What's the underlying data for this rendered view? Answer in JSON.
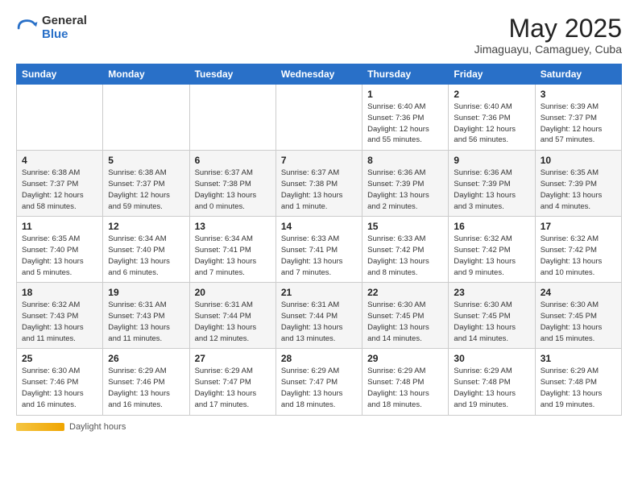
{
  "logo": {
    "general": "General",
    "blue": "Blue"
  },
  "title": "May 2025",
  "location": "Jimaguayu, Camaguey, Cuba",
  "days_of_week": [
    "Sunday",
    "Monday",
    "Tuesday",
    "Wednesday",
    "Thursday",
    "Friday",
    "Saturday"
  ],
  "footer": {
    "daylight_label": "Daylight hours"
  },
  "weeks": [
    [
      {
        "day": "",
        "info": ""
      },
      {
        "day": "",
        "info": ""
      },
      {
        "day": "",
        "info": ""
      },
      {
        "day": "",
        "info": ""
      },
      {
        "day": "1",
        "info": "Sunrise: 6:40 AM\nSunset: 7:36 PM\nDaylight: 12 hours\nand 55 minutes."
      },
      {
        "day": "2",
        "info": "Sunrise: 6:40 AM\nSunset: 7:36 PM\nDaylight: 12 hours\nand 56 minutes."
      },
      {
        "day": "3",
        "info": "Sunrise: 6:39 AM\nSunset: 7:37 PM\nDaylight: 12 hours\nand 57 minutes."
      }
    ],
    [
      {
        "day": "4",
        "info": "Sunrise: 6:38 AM\nSunset: 7:37 PM\nDaylight: 12 hours\nand 58 minutes."
      },
      {
        "day": "5",
        "info": "Sunrise: 6:38 AM\nSunset: 7:37 PM\nDaylight: 12 hours\nand 59 minutes."
      },
      {
        "day": "6",
        "info": "Sunrise: 6:37 AM\nSunset: 7:38 PM\nDaylight: 13 hours\nand 0 minutes."
      },
      {
        "day": "7",
        "info": "Sunrise: 6:37 AM\nSunset: 7:38 PM\nDaylight: 13 hours\nand 1 minute."
      },
      {
        "day": "8",
        "info": "Sunrise: 6:36 AM\nSunset: 7:39 PM\nDaylight: 13 hours\nand 2 minutes."
      },
      {
        "day": "9",
        "info": "Sunrise: 6:36 AM\nSunset: 7:39 PM\nDaylight: 13 hours\nand 3 minutes."
      },
      {
        "day": "10",
        "info": "Sunrise: 6:35 AM\nSunset: 7:39 PM\nDaylight: 13 hours\nand 4 minutes."
      }
    ],
    [
      {
        "day": "11",
        "info": "Sunrise: 6:35 AM\nSunset: 7:40 PM\nDaylight: 13 hours\nand 5 minutes."
      },
      {
        "day": "12",
        "info": "Sunrise: 6:34 AM\nSunset: 7:40 PM\nDaylight: 13 hours\nand 6 minutes."
      },
      {
        "day": "13",
        "info": "Sunrise: 6:34 AM\nSunset: 7:41 PM\nDaylight: 13 hours\nand 7 minutes."
      },
      {
        "day": "14",
        "info": "Sunrise: 6:33 AM\nSunset: 7:41 PM\nDaylight: 13 hours\nand 7 minutes."
      },
      {
        "day": "15",
        "info": "Sunrise: 6:33 AM\nSunset: 7:42 PM\nDaylight: 13 hours\nand 8 minutes."
      },
      {
        "day": "16",
        "info": "Sunrise: 6:32 AM\nSunset: 7:42 PM\nDaylight: 13 hours\nand 9 minutes."
      },
      {
        "day": "17",
        "info": "Sunrise: 6:32 AM\nSunset: 7:42 PM\nDaylight: 13 hours\nand 10 minutes."
      }
    ],
    [
      {
        "day": "18",
        "info": "Sunrise: 6:32 AM\nSunset: 7:43 PM\nDaylight: 13 hours\nand 11 minutes."
      },
      {
        "day": "19",
        "info": "Sunrise: 6:31 AM\nSunset: 7:43 PM\nDaylight: 13 hours\nand 11 minutes."
      },
      {
        "day": "20",
        "info": "Sunrise: 6:31 AM\nSunset: 7:44 PM\nDaylight: 13 hours\nand 12 minutes."
      },
      {
        "day": "21",
        "info": "Sunrise: 6:31 AM\nSunset: 7:44 PM\nDaylight: 13 hours\nand 13 minutes."
      },
      {
        "day": "22",
        "info": "Sunrise: 6:30 AM\nSunset: 7:45 PM\nDaylight: 13 hours\nand 14 minutes."
      },
      {
        "day": "23",
        "info": "Sunrise: 6:30 AM\nSunset: 7:45 PM\nDaylight: 13 hours\nand 14 minutes."
      },
      {
        "day": "24",
        "info": "Sunrise: 6:30 AM\nSunset: 7:45 PM\nDaylight: 13 hours\nand 15 minutes."
      }
    ],
    [
      {
        "day": "25",
        "info": "Sunrise: 6:30 AM\nSunset: 7:46 PM\nDaylight: 13 hours\nand 16 minutes."
      },
      {
        "day": "26",
        "info": "Sunrise: 6:29 AM\nSunset: 7:46 PM\nDaylight: 13 hours\nand 16 minutes."
      },
      {
        "day": "27",
        "info": "Sunrise: 6:29 AM\nSunset: 7:47 PM\nDaylight: 13 hours\nand 17 minutes."
      },
      {
        "day": "28",
        "info": "Sunrise: 6:29 AM\nSunset: 7:47 PM\nDaylight: 13 hours\nand 18 minutes."
      },
      {
        "day": "29",
        "info": "Sunrise: 6:29 AM\nSunset: 7:48 PM\nDaylight: 13 hours\nand 18 minutes."
      },
      {
        "day": "30",
        "info": "Sunrise: 6:29 AM\nSunset: 7:48 PM\nDaylight: 13 hours\nand 19 minutes."
      },
      {
        "day": "31",
        "info": "Sunrise: 6:29 AM\nSunset: 7:48 PM\nDaylight: 13 hours\nand 19 minutes."
      }
    ]
  ]
}
